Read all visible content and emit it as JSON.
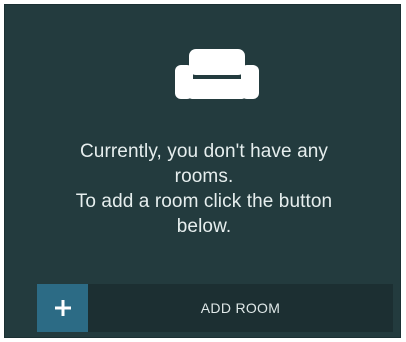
{
  "empty_state": {
    "icon": "sofa-icon",
    "line1": "Currently, you don't have any",
    "line2": "rooms.",
    "line3": "To add a room click the button",
    "line4": "below."
  },
  "add_room": {
    "icon": "plus-icon",
    "label": "ADD ROOM",
    "accent_color": "#2c6b85"
  },
  "colors": {
    "background": "#233b3e",
    "button_background": "#1c2f32",
    "text": "#e6eeee"
  }
}
